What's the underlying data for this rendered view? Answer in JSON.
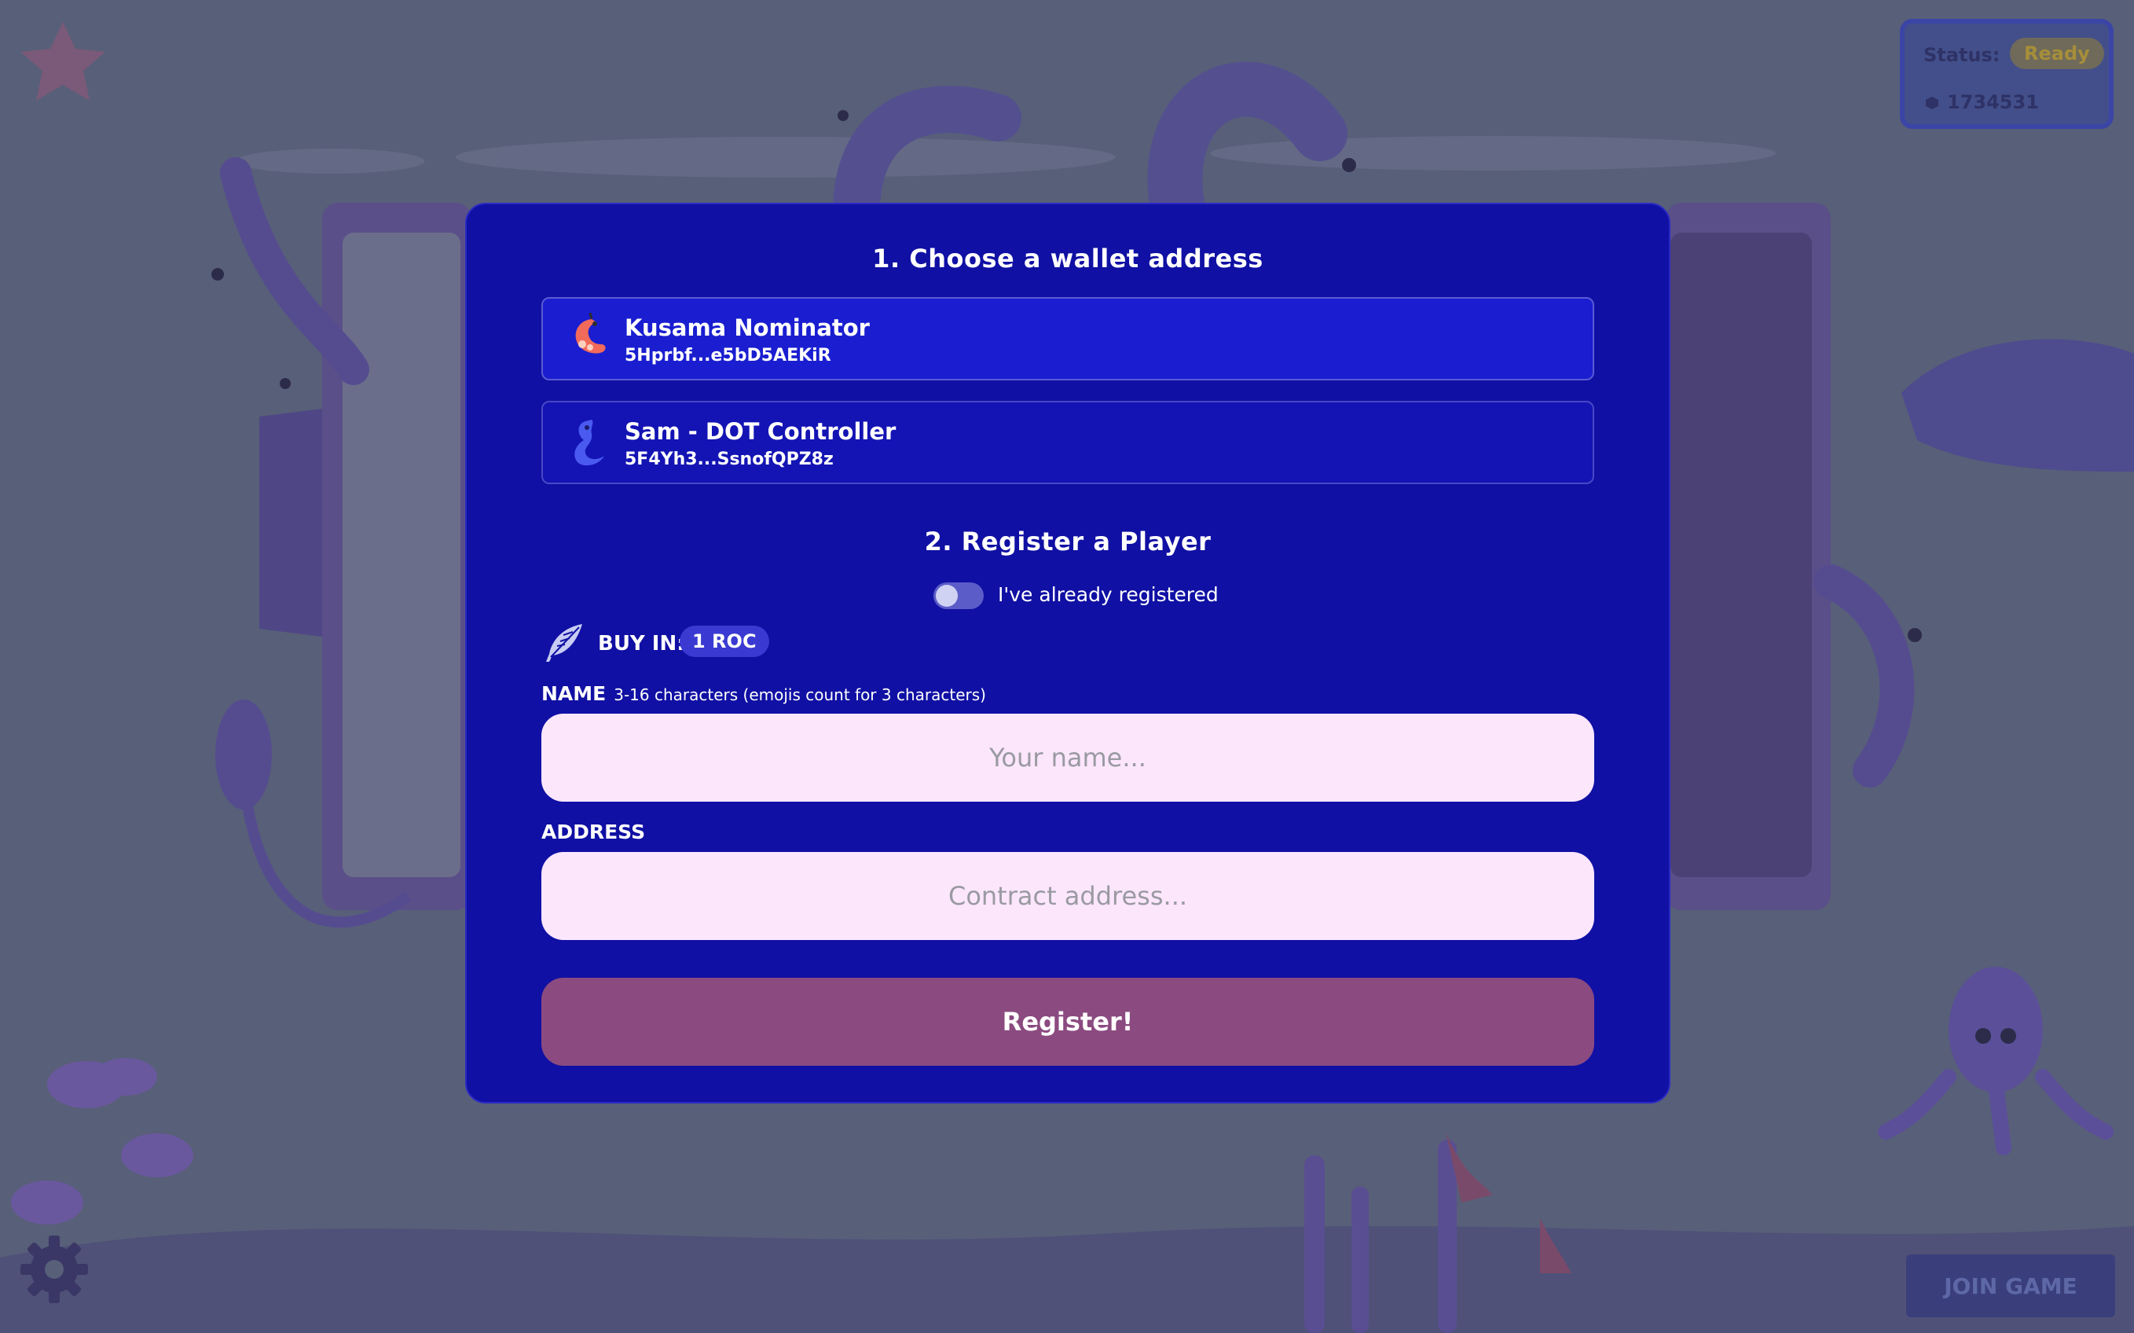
{
  "status": {
    "label": "Status:",
    "value": "Ready",
    "block_number": "1734531"
  },
  "modal": {
    "step1_title": "1. Choose a wallet address",
    "wallets": [
      {
        "name": "Kusama Nominator",
        "address": "5Hprbf...e5bD5AEKiR",
        "icon": "shrimp-icon",
        "selected": true
      },
      {
        "name": "Sam - DOT Controller",
        "address": "5F4Yh3...SsnofQPZ8z",
        "icon": "seahorse-icon",
        "selected": false
      }
    ],
    "step2_title": "2. Register a Player",
    "toggle_label": "I've already registered",
    "buy_in_label": "BUY IN:",
    "buy_in_value": "1 ROC",
    "name_label": "NAME",
    "name_hint": "3-16 characters (emojis count for 3 characters)",
    "name_placeholder": "Your name...",
    "address_label": "ADDRESS",
    "address_placeholder": "Contract address...",
    "register_label": "Register!"
  },
  "join_game_label": "JOIN GAME",
  "colors": {
    "modal_bg": "#1010a4",
    "input_bg": "#fce6fc",
    "register_bg": "#8b4a80",
    "scene_bg": "#585f79"
  }
}
